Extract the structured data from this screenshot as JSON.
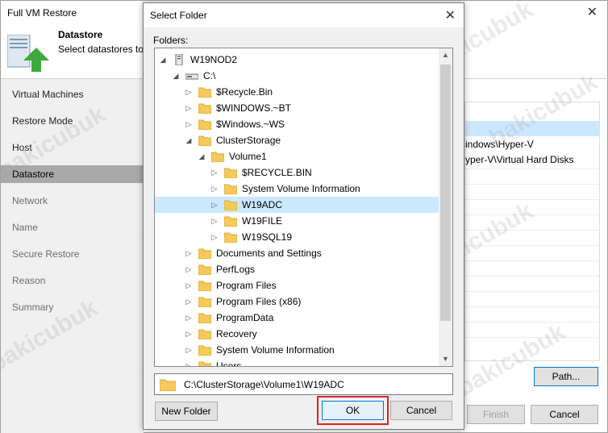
{
  "wizard": {
    "title": "Full VM Restore",
    "close_glyph": "✕",
    "header_title": "Datastore",
    "header_subtitle": "Select datastores to",
    "nav": [
      {
        "label": "Virtual Machines",
        "state": "normal"
      },
      {
        "label": "Restore Mode",
        "state": "normal"
      },
      {
        "label": "Host",
        "state": "normal"
      },
      {
        "label": "Datastore",
        "state": "active"
      },
      {
        "label": "Network",
        "state": "disabled"
      },
      {
        "label": "Name",
        "state": "disabled"
      },
      {
        "label": "Secure Restore",
        "state": "disabled"
      },
      {
        "label": "Reason",
        "state": "disabled"
      },
      {
        "label": "Summary",
        "state": "disabled"
      }
    ],
    "right_rows": [
      "indows\\Hyper-V",
      "yper-V\\Virtual Hard Disks"
    ],
    "path_button": "Path...",
    "finish_button": "Finish",
    "cancel_button": "Cancel"
  },
  "dialog": {
    "title": "Select Folder",
    "close_glyph": "✕",
    "folders_label": "Folders:",
    "tree": [
      {
        "label": "W19NOD2",
        "level": 0,
        "expander": "expanded",
        "icon": "computer-icon"
      },
      {
        "label": "C:\\",
        "level": 1,
        "expander": "expanded",
        "icon": "drive-icon"
      },
      {
        "label": "$Recycle.Bin",
        "level": 2,
        "expander": "collapsed",
        "icon": "folder-icon"
      },
      {
        "label": "$WINDOWS.~BT",
        "level": 2,
        "expander": "collapsed",
        "icon": "folder-icon"
      },
      {
        "label": "$Windows.~WS",
        "level": 2,
        "expander": "collapsed",
        "icon": "folder-icon"
      },
      {
        "label": "ClusterStorage",
        "level": 2,
        "expander": "expanded",
        "icon": "folder-icon"
      },
      {
        "label": "Volume1",
        "level": 3,
        "expander": "expanded",
        "icon": "folder-icon"
      },
      {
        "label": "$RECYCLE.BIN",
        "level": 4,
        "expander": "collapsed",
        "icon": "folder-icon"
      },
      {
        "label": "System Volume Information",
        "level": 4,
        "expander": "collapsed",
        "icon": "folder-icon"
      },
      {
        "label": "W19ADC",
        "level": 4,
        "expander": "collapsed",
        "icon": "folder-icon",
        "selected": true
      },
      {
        "label": "W19FILE",
        "level": 4,
        "expander": "collapsed",
        "icon": "folder-icon"
      },
      {
        "label": "W19SQL19",
        "level": 4,
        "expander": "collapsed",
        "icon": "folder-icon"
      },
      {
        "label": "Documents and Settings",
        "level": 2,
        "expander": "collapsed",
        "icon": "folder-icon"
      },
      {
        "label": "PerfLogs",
        "level": 2,
        "expander": "collapsed",
        "icon": "folder-icon"
      },
      {
        "label": "Program Files",
        "level": 2,
        "expander": "collapsed",
        "icon": "folder-icon"
      },
      {
        "label": "Program Files (x86)",
        "level": 2,
        "expander": "collapsed",
        "icon": "folder-icon"
      },
      {
        "label": "ProgramData",
        "level": 2,
        "expander": "collapsed",
        "icon": "folder-icon"
      },
      {
        "label": "Recovery",
        "level": 2,
        "expander": "collapsed",
        "icon": "folder-icon"
      },
      {
        "label": "System Volume Information",
        "level": 2,
        "expander": "collapsed",
        "icon": "folder-icon"
      },
      {
        "label": "Users",
        "level": 2,
        "expander": "collapsed",
        "icon": "folder-icon"
      }
    ],
    "selected_path": "C:\\ClusterStorage\\Volume1\\W19ADC",
    "new_folder_button": "New Folder",
    "ok_button": "OK",
    "cancel_button": "Cancel"
  },
  "watermark": "bakicubuk",
  "colors": {
    "selection": "#cce8ff",
    "focus_border": "#0078d7",
    "highlight_box": "#e0202a",
    "folder_yellow": "#f5c95a",
    "nav_active": "#a9a9a9"
  }
}
